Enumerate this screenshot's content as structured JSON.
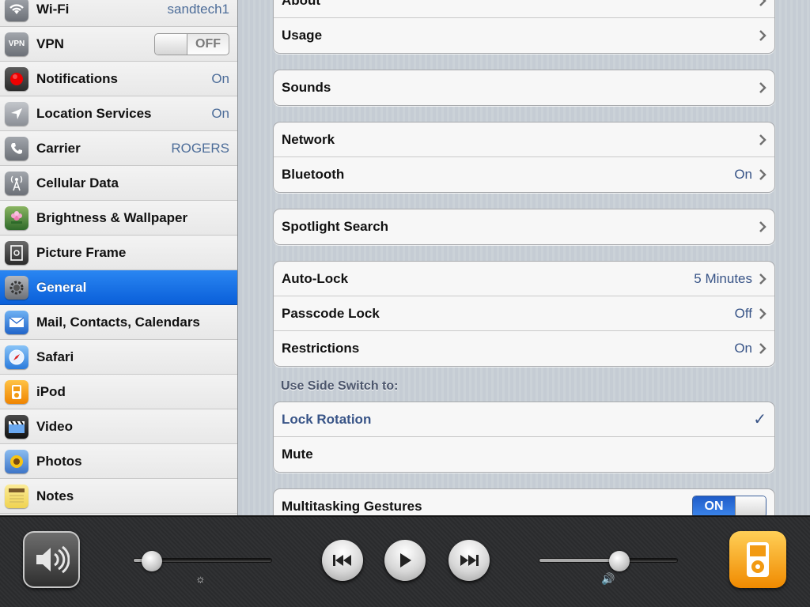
{
  "sidebar": {
    "items": [
      {
        "label": "Wi-Fi",
        "value": "sandtech1",
        "icon": "wifi-icon",
        "icon_color": "#7b7f86"
      },
      {
        "label": "VPN",
        "toggle": "OFF",
        "icon": "vpn-icon",
        "icon_text": "VPN",
        "icon_color": "#7b7f86"
      },
      {
        "label": "Notifications",
        "value": "On",
        "icon": "notifications-icon",
        "icon_color": "#3d3d3d"
      },
      {
        "label": "Location Services",
        "value": "On",
        "icon": "location-arrow-icon",
        "icon_color": "#8b8f96"
      },
      {
        "label": "Carrier",
        "value": "ROGERS",
        "icon": "phone-icon",
        "icon_color": "#7b7f86"
      },
      {
        "label": "Cellular Data",
        "value": "",
        "icon": "antenna-icon",
        "icon_color": "#7b7f86"
      },
      {
        "label": "Brightness & Wallpaper",
        "value": "",
        "icon": "flower-icon",
        "icon_color": "#4a8a3c"
      },
      {
        "label": "Picture Frame",
        "value": "",
        "icon": "picture-frame-icon",
        "icon_color": "#3f3f3f"
      },
      {
        "label": "General",
        "value": "",
        "icon": "gear-icon",
        "icon_color": "#7b7f86",
        "selected": true
      },
      {
        "label": "Mail, Contacts, Calendars",
        "value": "",
        "icon": "mail-icon",
        "icon_color": "#3d7fd8"
      },
      {
        "label": "Safari",
        "value": "",
        "icon": "compass-icon",
        "icon_color": "#3d89e0"
      },
      {
        "label": "iPod",
        "value": "",
        "icon": "ipod-icon",
        "icon_color": "#f29a12"
      },
      {
        "label": "Video",
        "value": "",
        "icon": "clapperboard-icon",
        "icon_color": "#2d2d2d"
      },
      {
        "label": "Photos",
        "value": "",
        "icon": "sunflower-icon",
        "icon_color": "#5d8fd9"
      },
      {
        "label": "Notes",
        "value": "",
        "icon": "notepad-icon",
        "icon_color": "#f7e27a"
      }
    ]
  },
  "detail": {
    "group1": [
      {
        "label": "About",
        "value": ""
      },
      {
        "label": "Usage",
        "value": ""
      }
    ],
    "group2": [
      {
        "label": "Sounds",
        "value": ""
      }
    ],
    "group3": [
      {
        "label": "Network",
        "value": ""
      },
      {
        "label": "Bluetooth",
        "value": "On"
      }
    ],
    "group4": [
      {
        "label": "Spotlight Search",
        "value": ""
      }
    ],
    "group5": [
      {
        "label": "Auto-Lock",
        "value": "5 Minutes"
      },
      {
        "label": "Passcode Lock",
        "value": "Off"
      },
      {
        "label": "Restrictions",
        "value": "On"
      }
    ],
    "side_switch_header": "Use Side Switch to:",
    "group6": [
      {
        "label": "Lock Rotation",
        "checked": true
      },
      {
        "label": "Mute",
        "checked": false
      }
    ],
    "group7": [
      {
        "label": "Multitasking Gestures",
        "toggle": "ON"
      }
    ]
  },
  "tray": {
    "brightness_level": 0.13,
    "volume_level": 0.58,
    "buttons": [
      "mute-toggle",
      "previous-track",
      "play",
      "next-track",
      "ipod-app"
    ]
  }
}
